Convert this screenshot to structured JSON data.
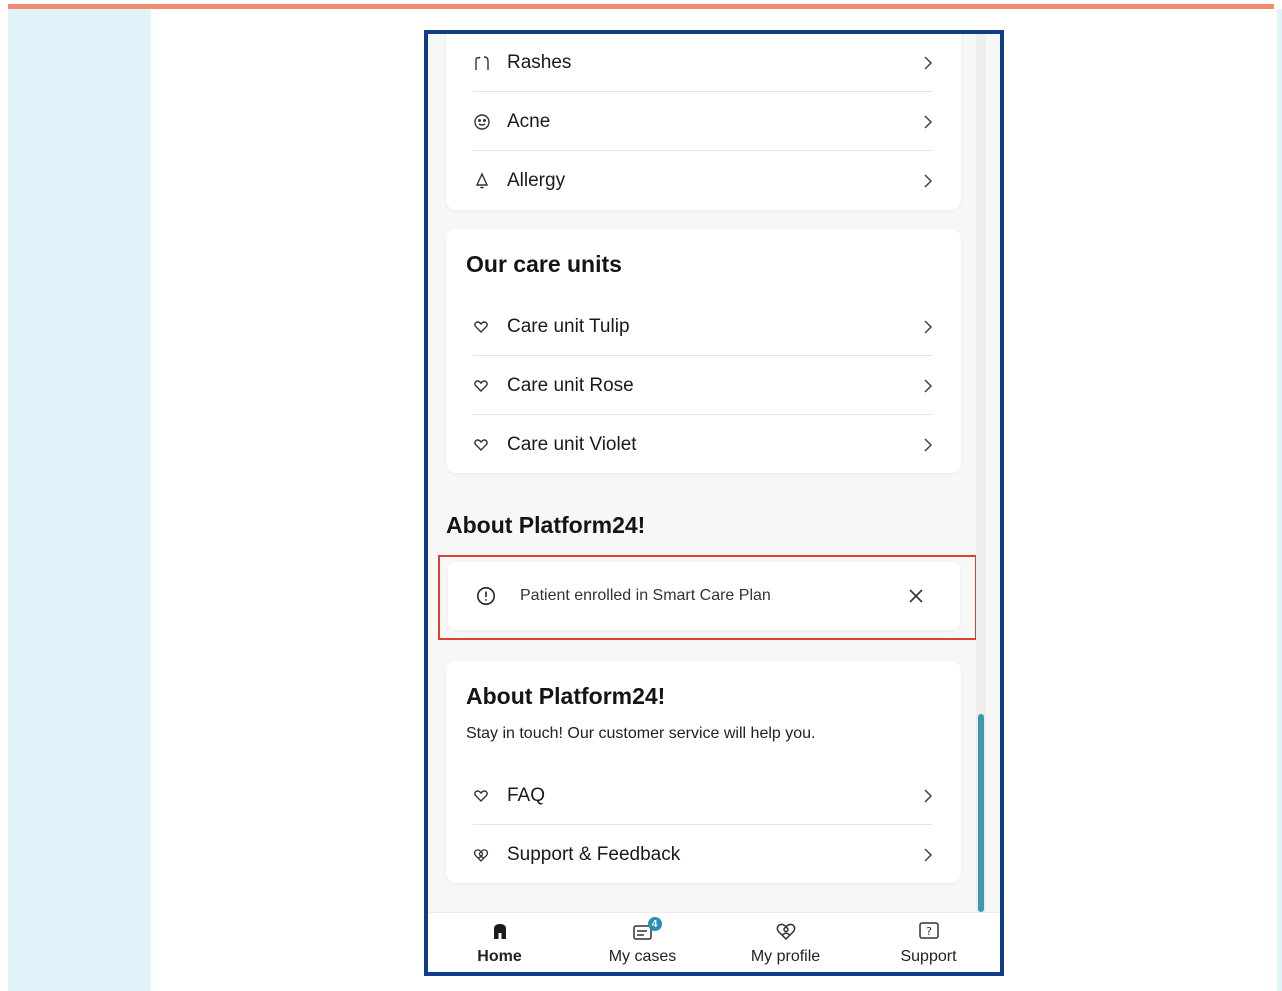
{
  "colors": {
    "accent_bar": "#f28b70",
    "side_panel": "#e2f3f9",
    "frame_border": "#123b8a",
    "highlight_border": "#d9432f",
    "scroll_thumb": "#3f97b0",
    "badge": "#2a8fb5"
  },
  "symptoms": {
    "items": [
      {
        "label": "Rashes",
        "icon": "rash-icon"
      },
      {
        "label": "Acne",
        "icon": "face-icon"
      },
      {
        "label": "Allergy",
        "icon": "bell-icon"
      }
    ]
  },
  "care_units": {
    "title": "Our care units",
    "items": [
      {
        "label": "Care unit Tulip",
        "icon": "heart-icon"
      },
      {
        "label": "Care unit Rose",
        "icon": "heart-icon"
      },
      {
        "label": "Care unit Violet",
        "icon": "heart-icon"
      }
    ]
  },
  "about_heading": "About Platform24!",
  "alert": {
    "text": "Patient enrolled in Smart Care Plan",
    "icon": "info-icon",
    "close_icon": "close-icon"
  },
  "about_card": {
    "title": "About Platform24!",
    "subtitle": "Stay in touch! Our customer service will help you.",
    "items": [
      {
        "label": "FAQ",
        "icon": "heart-icon"
      },
      {
        "label": "Support & Feedback",
        "icon": "heart-person-icon"
      }
    ]
  },
  "bottom_nav": {
    "items": [
      {
        "label": "Home",
        "icon": "home-icon",
        "active": true
      },
      {
        "label": "My cases",
        "icon": "cases-icon",
        "badge": "4"
      },
      {
        "label": "My profile",
        "icon": "profile-icon"
      },
      {
        "label": "Support",
        "icon": "support-icon"
      }
    ]
  }
}
